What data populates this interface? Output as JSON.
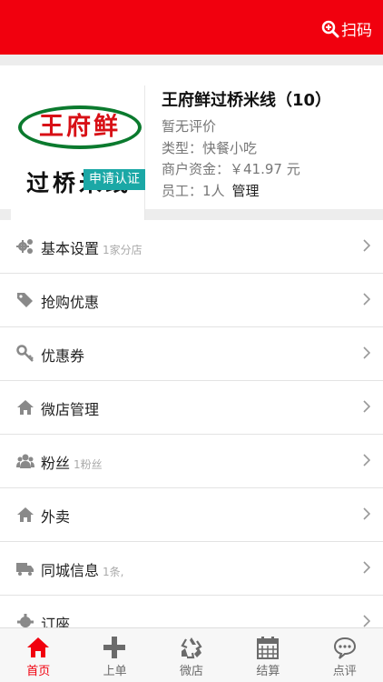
{
  "header": {
    "scan_label": "扫码",
    "scan_icon": "search-icon"
  },
  "shop": {
    "logo": {
      "main_text": "王府鲜",
      "sub_text": "过桥米线"
    },
    "badge": "申请认证",
    "name": "王府鲜过桥米线（10）",
    "rating": "暂无评价",
    "type": "类型：快餐小吃",
    "funds": "商户资金：￥41.97 元",
    "staff": "员工：1人",
    "manage": "管理"
  },
  "menu": [
    {
      "icon": "gears-icon",
      "label": "基本设置",
      "sub": "1家分店"
    },
    {
      "icon": "tags-icon",
      "label": "抢购优惠",
      "sub": ""
    },
    {
      "icon": "key-icon",
      "label": "优惠券",
      "sub": ""
    },
    {
      "icon": "home-icon",
      "label": "微店管理",
      "sub": ""
    },
    {
      "icon": "users-icon",
      "label": "粉丝",
      "sub": "1粉丝"
    },
    {
      "icon": "home-icon",
      "label": "外卖",
      "sub": ""
    },
    {
      "icon": "truck-icon",
      "label": "同城信息",
      "sub": "1条,"
    },
    {
      "icon": "gear-icon",
      "label": "订座",
      "sub": ""
    }
  ],
  "nav": [
    {
      "icon": "home-icon",
      "label": "首页",
      "active": true
    },
    {
      "icon": "plus-icon",
      "label": "上单",
      "active": false
    },
    {
      "icon": "recycle-icon",
      "label": "微店",
      "active": false
    },
    {
      "icon": "calendar-icon",
      "label": "结算",
      "active": false
    },
    {
      "icon": "comment-icon",
      "label": "点评",
      "active": false
    }
  ],
  "colors": {
    "brand": "#f1000e",
    "badge": "#1ba8a6",
    "logo_green": "#0b7a2e"
  }
}
